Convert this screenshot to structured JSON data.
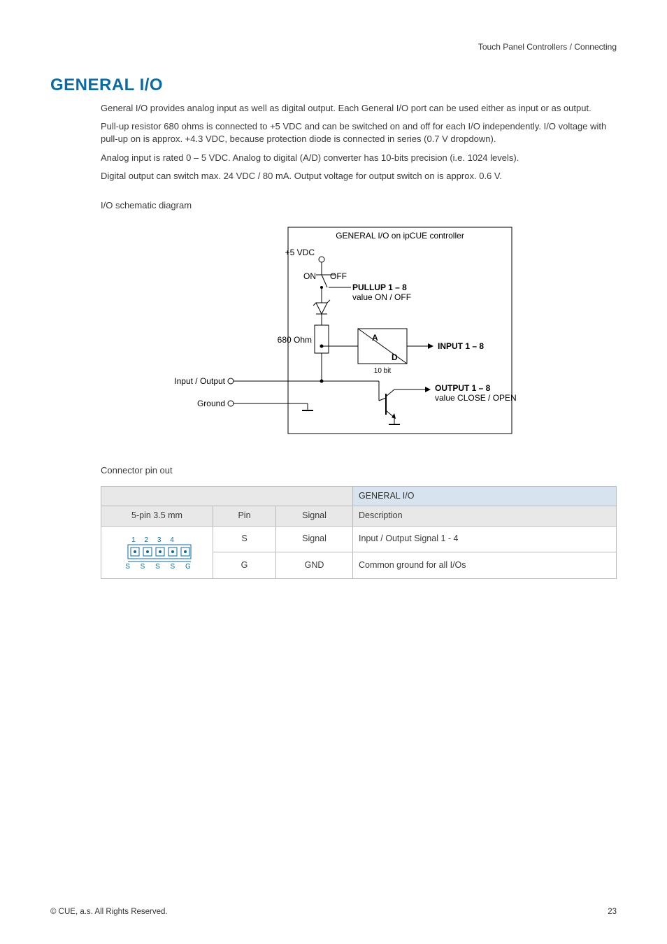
{
  "header": {
    "path": "Touch Panel Controllers / Connecting"
  },
  "section": {
    "title": "GENERAL I/O"
  },
  "paragraphs": {
    "p1": "General I/O provides analog input as well as digital output. Each General I/O port can be used either as input or as output.",
    "p2": "Pull-up resistor 680 ohms is connected to +5 VDC and can be switched on and off for each I/O independently. I/O voltage with pull-up on is approx. +4.3 VDC, because protection diode is connected in series (0.7 V dropdown).",
    "p3": "Analog input is rated 0 – 5 VDC. Analog to digital (A/D) converter has 10-bits precision (i.e. 1024 levels).",
    "p4": "Digital output can switch max. 24 VDC / 80 mA. Output voltage for output switch on is approx. 0.6 V."
  },
  "subheadings": {
    "schematic": "I/O schematic diagram",
    "pinout": "Connector pin out"
  },
  "diagram": {
    "title": "GENERAL I/O on ipCUE controller",
    "v5": "+5 VDC",
    "on": "ON",
    "off": "OFF",
    "pullup1": "PULLUP 1 – 8",
    "pullup2": "value ON / OFF",
    "r680": "680 Ohm",
    "a": "A",
    "d": "D",
    "bits": "10 bit",
    "input": "INPUT 1 – 8",
    "output1": "OUTPUT 1 – 8",
    "output2": "value CLOSE / OPEN",
    "io": "Input / Output",
    "gnd": "Ground"
  },
  "table": {
    "header_main": "GENERAL I/O",
    "col_conn": "5-pin 3.5 mm",
    "col_pin": "Pin",
    "col_signal": "Signal",
    "col_desc": "Description",
    "rows": [
      {
        "pin": "S",
        "signal": "Signal",
        "desc": "Input / Output Signal 1 - 4"
      },
      {
        "pin": "G",
        "signal": "GND",
        "desc": "Common ground for all I/Os"
      }
    ],
    "conn_labels_top": "1  2  3  4",
    "conn_labels_bottom": "S  S  S  S  G"
  },
  "footer": {
    "copyright": "© CUE, a.s. All Rights Reserved.",
    "page": "23"
  }
}
